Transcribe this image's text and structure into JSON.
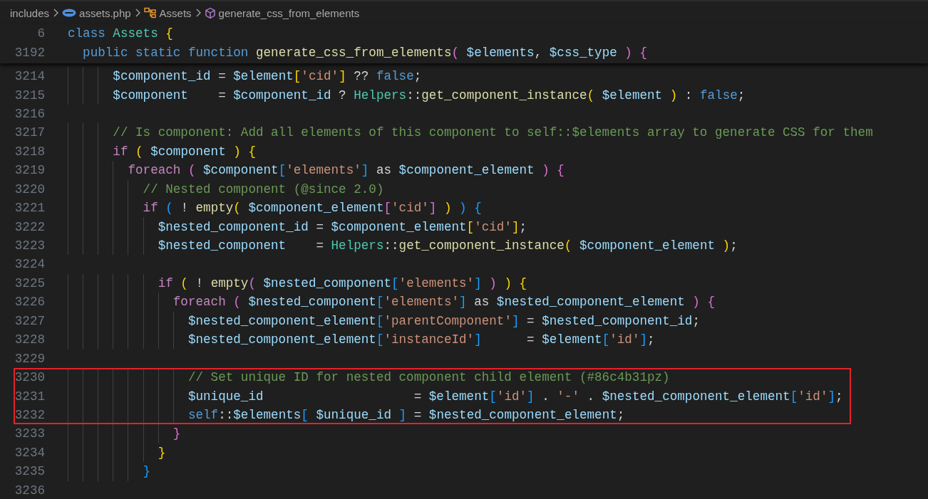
{
  "breadcrumbs": [
    {
      "kind": "folder",
      "label": "includes"
    },
    {
      "kind": "file",
      "label": "assets.php"
    },
    {
      "kind": "class",
      "label": "Assets"
    },
    {
      "kind": "method",
      "label": "generate_css_from_elements"
    }
  ],
  "sticky_lines": [
    {
      "number": "6",
      "tokens": [
        {
          "kind": "kw",
          "text": "class"
        },
        {
          "kind": "type",
          "text": " Assets"
        },
        {
          "kind": "b1",
          "text": " {"
        }
      ]
    },
    {
      "number": "3192",
      "tokens": [
        {
          "kind": "kw",
          "text": "  public"
        },
        {
          "kind": "kw",
          "text": " static"
        },
        {
          "kind": "kw",
          "text": " function"
        },
        {
          "kind": "fn",
          "text": " generate_css_from_elements"
        },
        {
          "kind": "b2",
          "text": "("
        },
        {
          "kind": "var",
          "text": " $elements"
        },
        {
          "kind": "txt",
          "text": ", "
        },
        {
          "kind": "var",
          "text": "$css_type"
        },
        {
          "kind": "b2",
          "text": " )"
        },
        {
          "kind": "b2",
          "text": " {"
        }
      ]
    }
  ],
  "lines": [
    {
      "number": "3214",
      "highlighted": false,
      "tokens": [
        {
          "kind": "var",
          "text": "      $component_id"
        },
        {
          "kind": "txt",
          "text": " = "
        },
        {
          "kind": "var",
          "text": "$element"
        },
        {
          "kind": "b1",
          "text": "["
        },
        {
          "kind": "str",
          "text": "'cid'"
        },
        {
          "kind": "b1",
          "text": "]"
        },
        {
          "kind": "txt",
          "text": " ?? "
        },
        {
          "kind": "kw",
          "text": "false"
        },
        {
          "kind": "txt",
          "text": ";"
        }
      ]
    },
    {
      "number": "3215",
      "highlighted": false,
      "tokens": [
        {
          "kind": "var",
          "text": "      $component"
        },
        {
          "kind": "txt",
          "text": "    = "
        },
        {
          "kind": "var",
          "text": "$component_id"
        },
        {
          "kind": "txt",
          "text": " ? "
        },
        {
          "kind": "type",
          "text": "Helpers"
        },
        {
          "kind": "txt",
          "text": "::"
        },
        {
          "kind": "fn",
          "text": "get_component_instance"
        },
        {
          "kind": "b1",
          "text": "("
        },
        {
          "kind": "var",
          "text": " $element"
        },
        {
          "kind": "b1",
          "text": " )"
        },
        {
          "kind": "txt",
          "text": " : "
        },
        {
          "kind": "kw",
          "text": "false"
        },
        {
          "kind": "txt",
          "text": ";"
        }
      ]
    },
    {
      "number": "3216",
      "highlighted": false
    },
    {
      "number": "3217",
      "highlighted": false,
      "tokens": [
        {
          "kind": "cmt",
          "text": "      // Is component: Add all elements of this component to self::$elements array to generate CSS for them"
        }
      ]
    },
    {
      "number": "3218",
      "highlighted": false,
      "tokens": [
        {
          "kind": "ctl",
          "text": "      if"
        },
        {
          "kind": "b1",
          "text": " ("
        },
        {
          "kind": "var",
          "text": " $component"
        },
        {
          "kind": "b1",
          "text": " )"
        },
        {
          "kind": "b1",
          "text": " {"
        }
      ]
    },
    {
      "number": "3219",
      "highlighted": false,
      "tokens": [
        {
          "kind": "ctl",
          "text": "        foreach"
        },
        {
          "kind": "b2",
          "text": " ("
        },
        {
          "kind": "var",
          "text": " $component"
        },
        {
          "kind": "b3",
          "text": "["
        },
        {
          "kind": "str",
          "text": "'elements'"
        },
        {
          "kind": "b3",
          "text": "]"
        },
        {
          "kind": "txt",
          "text": " as "
        },
        {
          "kind": "var",
          "text": "$component_element"
        },
        {
          "kind": "b2",
          "text": " )"
        },
        {
          "kind": "b2",
          "text": " {"
        }
      ]
    },
    {
      "number": "3220",
      "highlighted": false,
      "tokens": [
        {
          "kind": "cmt",
          "text": "          // Nested component (@since 2.0)"
        }
      ]
    },
    {
      "number": "3221",
      "highlighted": false,
      "tokens": [
        {
          "kind": "ctl",
          "text": "          if"
        },
        {
          "kind": "b3",
          "text": " ("
        },
        {
          "kind": "txt",
          "text": " ! "
        },
        {
          "kind": "fn",
          "text": "empty"
        },
        {
          "kind": "b1",
          "text": "("
        },
        {
          "kind": "var",
          "text": " $component_element"
        },
        {
          "kind": "b2",
          "text": "["
        },
        {
          "kind": "str",
          "text": "'cid'"
        },
        {
          "kind": "b2",
          "text": "]"
        },
        {
          "kind": "b1",
          "text": " )"
        },
        {
          "kind": "b3",
          "text": " )"
        },
        {
          "kind": "b3",
          "text": " {"
        }
      ]
    },
    {
      "number": "3222",
      "highlighted": false,
      "tokens": [
        {
          "kind": "var",
          "text": "            $nested_component_id"
        },
        {
          "kind": "txt",
          "text": " = "
        },
        {
          "kind": "var",
          "text": "$component_element"
        },
        {
          "kind": "b1",
          "text": "["
        },
        {
          "kind": "str",
          "text": "'cid'"
        },
        {
          "kind": "b1",
          "text": "]"
        },
        {
          "kind": "txt",
          "text": ";"
        }
      ]
    },
    {
      "number": "3223",
      "highlighted": false,
      "tokens": [
        {
          "kind": "var",
          "text": "            $nested_component"
        },
        {
          "kind": "txt",
          "text": "    = "
        },
        {
          "kind": "type",
          "text": "Helpers"
        },
        {
          "kind": "txt",
          "text": "::"
        },
        {
          "kind": "fn",
          "text": "get_component_instance"
        },
        {
          "kind": "b1",
          "text": "("
        },
        {
          "kind": "var",
          "text": " $component_element"
        },
        {
          "kind": "b1",
          "text": " )"
        },
        {
          "kind": "txt",
          "text": ";"
        }
      ]
    },
    {
      "number": "3224",
      "highlighted": false
    },
    {
      "number": "3225",
      "highlighted": false,
      "tokens": [
        {
          "kind": "ctl",
          "text": "            if"
        },
        {
          "kind": "b1",
          "text": " ("
        },
        {
          "kind": "txt",
          "text": " ! "
        },
        {
          "kind": "fn",
          "text": "empty"
        },
        {
          "kind": "b2",
          "text": "("
        },
        {
          "kind": "var",
          "text": " $nested_component"
        },
        {
          "kind": "b3",
          "text": "["
        },
        {
          "kind": "str",
          "text": "'elements'"
        },
        {
          "kind": "b3",
          "text": "]"
        },
        {
          "kind": "b2",
          "text": " )"
        },
        {
          "kind": "b1",
          "text": " )"
        },
        {
          "kind": "b1",
          "text": " {"
        }
      ]
    },
    {
      "number": "3226",
      "highlighted": false,
      "tokens": [
        {
          "kind": "ctl",
          "text": "              foreach"
        },
        {
          "kind": "b2",
          "text": " ("
        },
        {
          "kind": "var",
          "text": " $nested_component"
        },
        {
          "kind": "b3",
          "text": "["
        },
        {
          "kind": "str",
          "text": "'elements'"
        },
        {
          "kind": "b3",
          "text": "]"
        },
        {
          "kind": "txt",
          "text": " as "
        },
        {
          "kind": "var",
          "text": "$nested_component_element"
        },
        {
          "kind": "b2",
          "text": " )"
        },
        {
          "kind": "b2",
          "text": " {"
        }
      ]
    },
    {
      "number": "3227",
      "highlighted": false,
      "tokens": [
        {
          "kind": "var",
          "text": "                $nested_component_element"
        },
        {
          "kind": "b3",
          "text": "["
        },
        {
          "kind": "str",
          "text": "'parentComponent'"
        },
        {
          "kind": "b3",
          "text": "]"
        },
        {
          "kind": "txt",
          "text": " = "
        },
        {
          "kind": "var",
          "text": "$nested_component_id"
        },
        {
          "kind": "txt",
          "text": ";"
        }
      ]
    },
    {
      "number": "3228",
      "highlighted": false,
      "tokens": [
        {
          "kind": "var",
          "text": "                $nested_component_element"
        },
        {
          "kind": "b3",
          "text": "["
        },
        {
          "kind": "str",
          "text": "'instanceId'"
        },
        {
          "kind": "b3",
          "text": "]"
        },
        {
          "kind": "txt",
          "text": "      = "
        },
        {
          "kind": "var",
          "text": "$element"
        },
        {
          "kind": "b3",
          "text": "["
        },
        {
          "kind": "str",
          "text": "'id'"
        },
        {
          "kind": "b3",
          "text": "]"
        },
        {
          "kind": "txt",
          "text": ";"
        }
      ]
    },
    {
      "number": "3229",
      "highlighted": false
    },
    {
      "number": "3230",
      "highlighted": true,
      "tokens": [
        {
          "kind": "cmt",
          "text": "                // Set unique ID for nested component child element (#86c4b31pz)"
        }
      ]
    },
    {
      "number": "3231",
      "highlighted": true,
      "tokens": [
        {
          "kind": "var",
          "text": "                $unique_id"
        },
        {
          "kind": "txt",
          "text": "                    = "
        },
        {
          "kind": "var",
          "text": "$element"
        },
        {
          "kind": "b3",
          "text": "["
        },
        {
          "kind": "str",
          "text": "'id'"
        },
        {
          "kind": "b3",
          "text": "]"
        },
        {
          "kind": "txt",
          "text": " . "
        },
        {
          "kind": "str",
          "text": "'-'"
        },
        {
          "kind": "txt",
          "text": " . "
        },
        {
          "kind": "var",
          "text": "$nested_component_element"
        },
        {
          "kind": "b3",
          "text": "["
        },
        {
          "kind": "str",
          "text": "'id'"
        },
        {
          "kind": "b3",
          "text": "]"
        },
        {
          "kind": "txt",
          "text": ";"
        }
      ]
    },
    {
      "number": "3232",
      "highlighted": true,
      "tokens": [
        {
          "kind": "kw",
          "text": "                self"
        },
        {
          "kind": "txt",
          "text": "::"
        },
        {
          "kind": "var",
          "text": "$elements"
        },
        {
          "kind": "b3",
          "text": "["
        },
        {
          "kind": "var",
          "text": " $unique_id"
        },
        {
          "kind": "b3",
          "text": " ]"
        },
        {
          "kind": "txt",
          "text": " = "
        },
        {
          "kind": "var",
          "text": "$nested_component_element"
        },
        {
          "kind": "txt",
          "text": ";"
        }
      ]
    },
    {
      "number": "3233",
      "highlighted": false,
      "tokens": [
        {
          "kind": "b2",
          "text": "              }"
        }
      ]
    },
    {
      "number": "3234",
      "highlighted": false,
      "tokens": [
        {
          "kind": "b1",
          "text": "            }"
        }
      ]
    },
    {
      "number": "3235",
      "highlighted": false,
      "tokens": [
        {
          "kind": "b3",
          "text": "          }"
        }
      ]
    },
    {
      "number": "3236",
      "highlighted": false
    }
  ]
}
